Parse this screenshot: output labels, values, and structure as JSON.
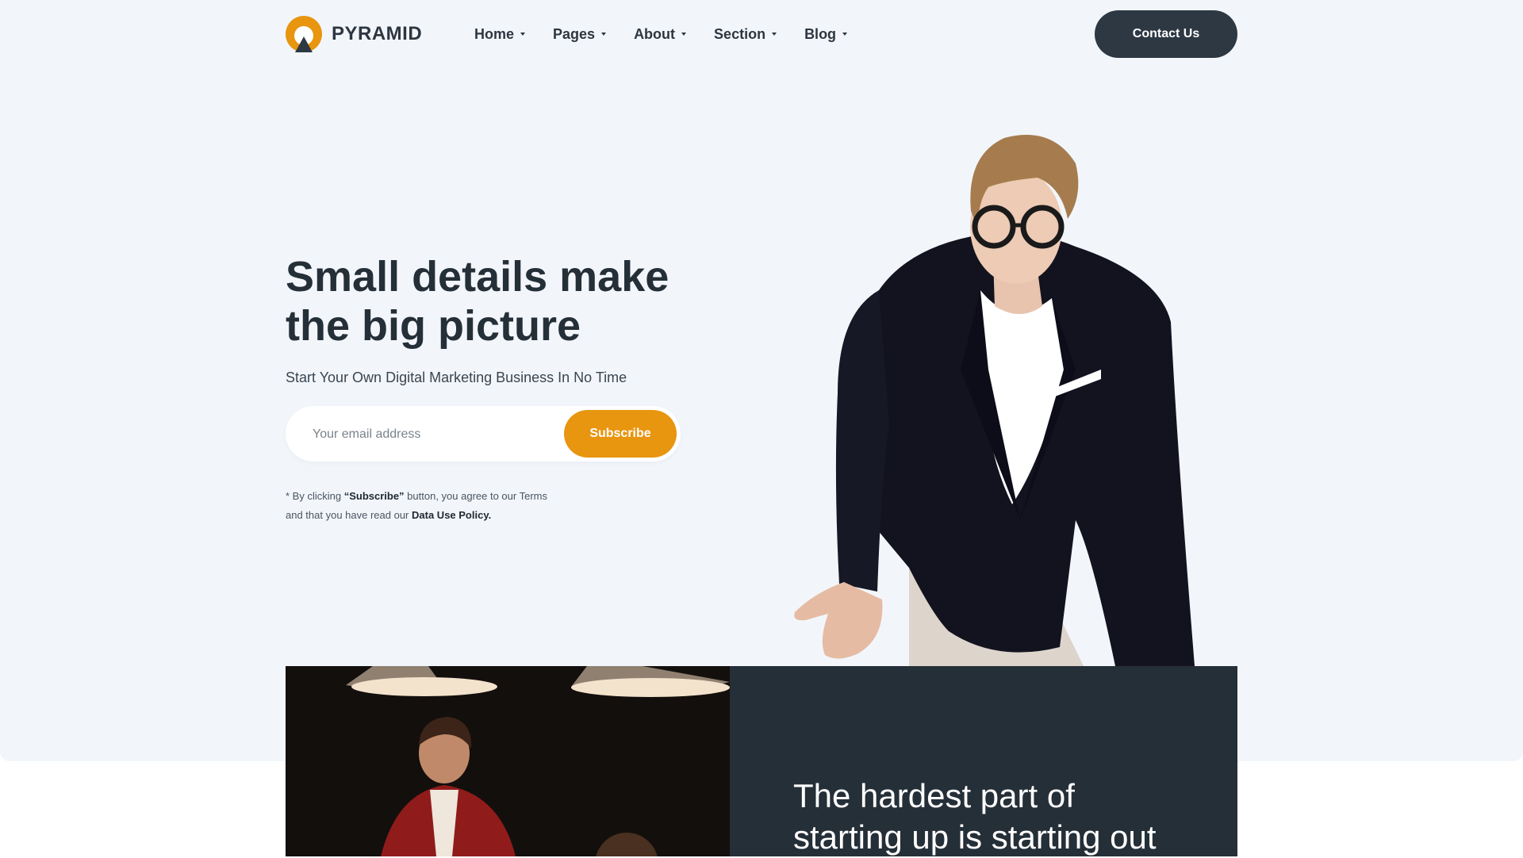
{
  "brand": {
    "name": "PYRAMID",
    "accent": "#e8950f",
    "dark": "#2d3843"
  },
  "nav": {
    "items": [
      {
        "label": "Home"
      },
      {
        "label": "Pages"
      },
      {
        "label": "About"
      },
      {
        "label": "Section"
      },
      {
        "label": "Blog"
      }
    ],
    "contact_label": "Contact Us"
  },
  "hero": {
    "title_line1": "Small details make",
    "title_line2": "the big picture",
    "subtitle": "Start Your Own Digital Marketing Business In No Time",
    "email_placeholder": "Your email address",
    "subscribe_label": "Subscribe",
    "terms": {
      "prefix": "* By clicking ",
      "subscribe_quote": "“Subscribe”",
      "middle": " button, you agree to our Terms",
      "line2_prefix": "and that you have read our ",
      "policy": "Data Use Policy."
    }
  },
  "feature": {
    "title_line1": "The hardest part of",
    "title_line2": "starting up is starting out"
  }
}
